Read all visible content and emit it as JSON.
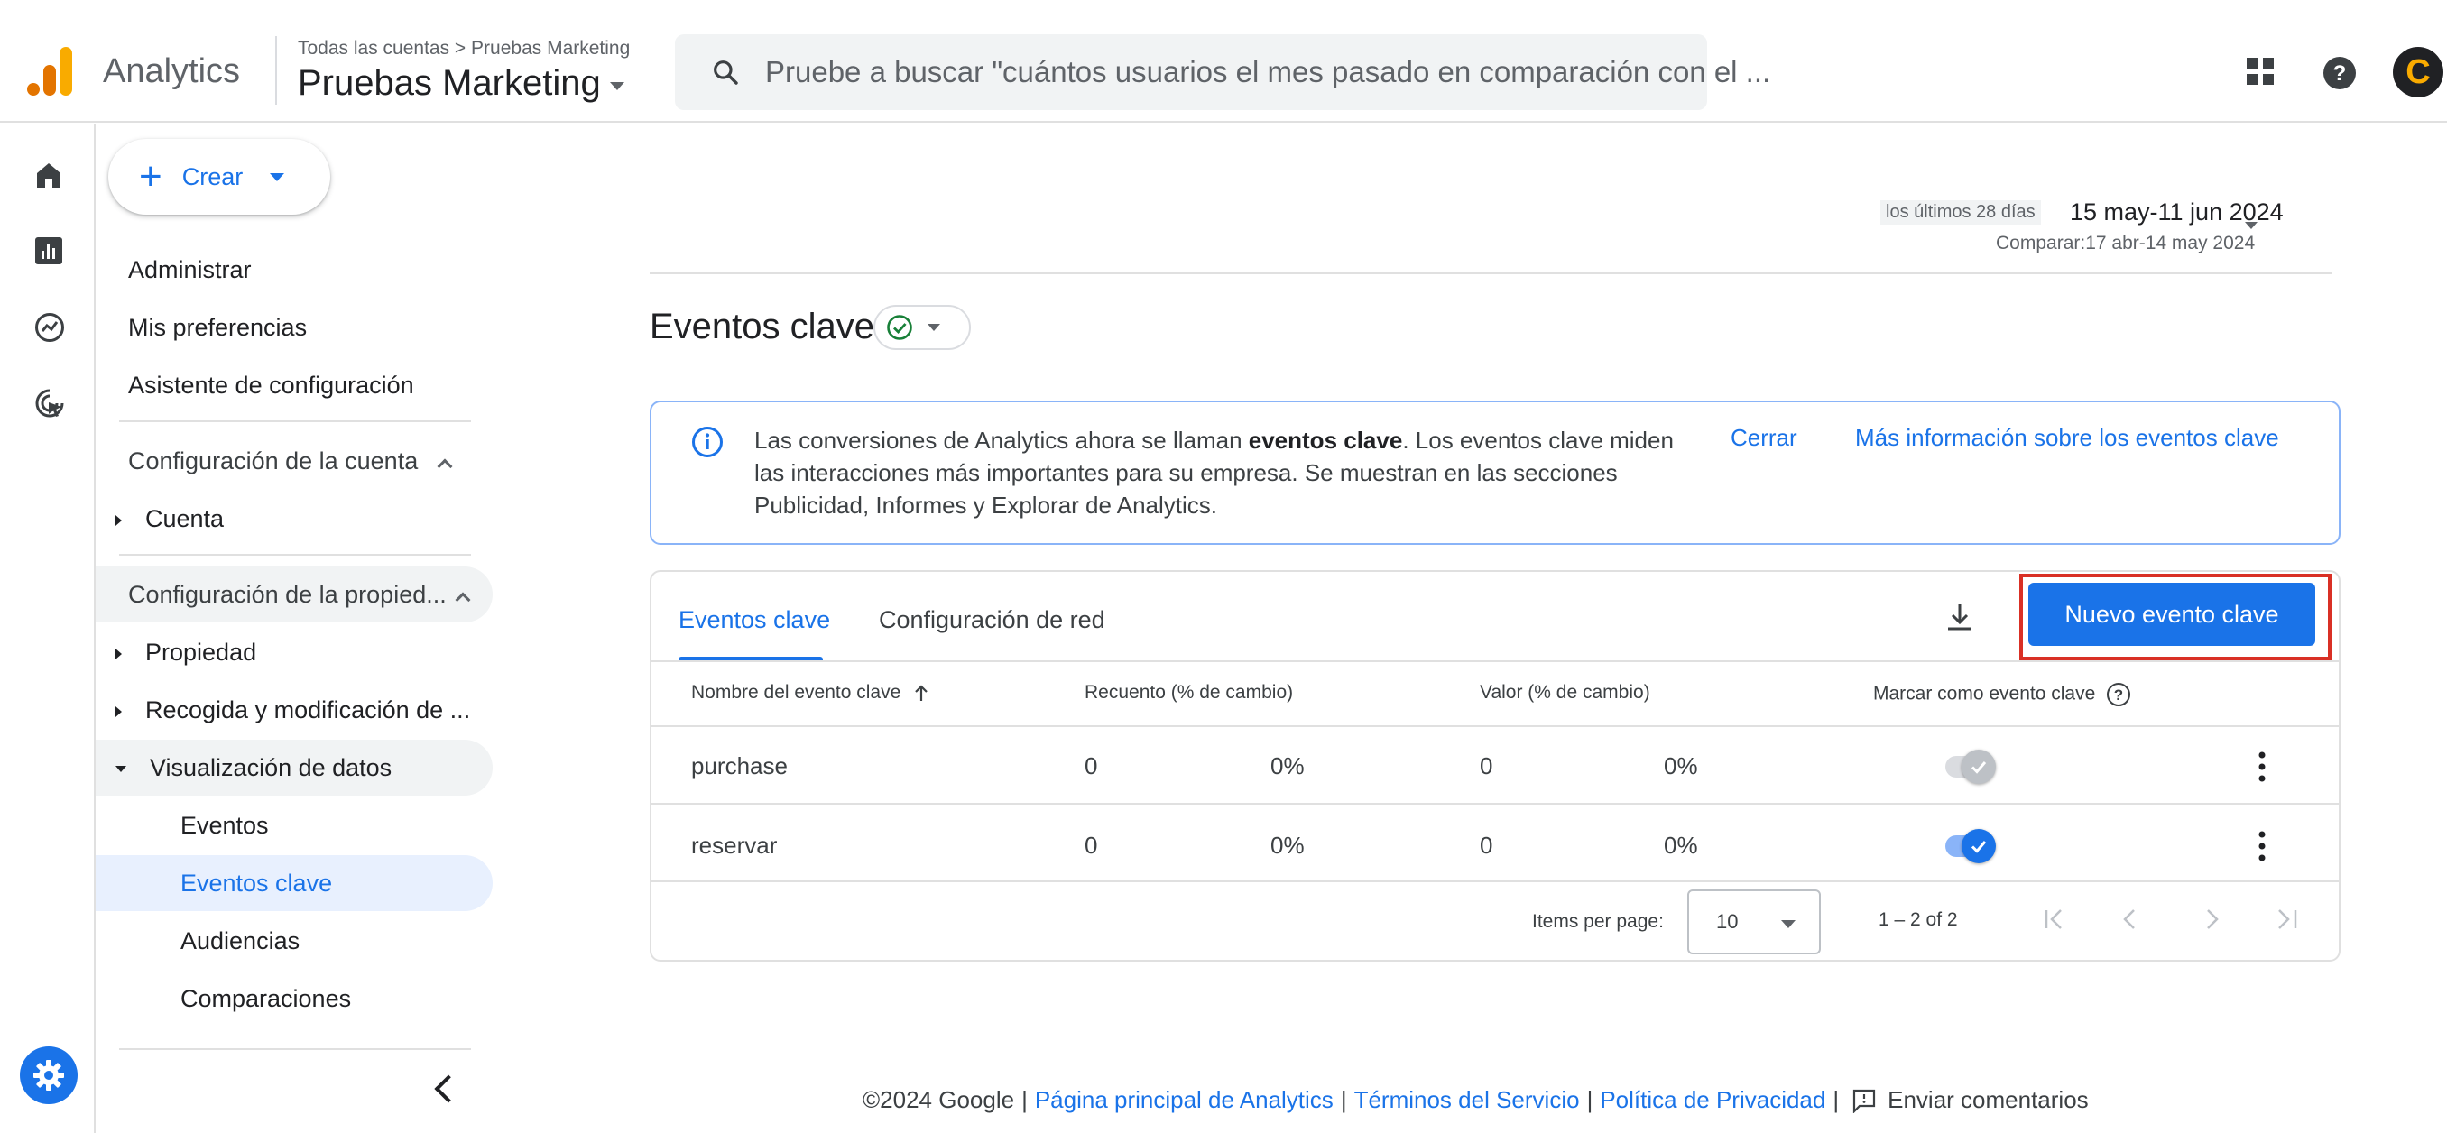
{
  "header": {
    "app_name": "Analytics",
    "breadcrumb": "Todas las cuentas > Pruebas Marketing",
    "property_name": "Pruebas Marketing",
    "search_placeholder": "Pruebe a buscar \"cuántos usuarios el mes pasado en comparación con el ...",
    "avatar_letter": "C"
  },
  "sidebar": {
    "create_label": "Crear",
    "top_items": [
      "Administrar",
      "Mis preferencias",
      "Asistente de configuración"
    ],
    "account_section": "Configuración de la cuenta",
    "account_item": "Cuenta",
    "property_section": "Configuración de la propied...",
    "property_item": "Propiedad",
    "collection_item": "Recogida y modificación de ...",
    "data_display_item": "Visualización de datos",
    "sub_items": [
      "Eventos",
      "Eventos clave",
      "Audiencias",
      "Comparaciones"
    ]
  },
  "date": {
    "label": "los últimos 28 días",
    "range": "15 may-11 jun 2024",
    "compare": "Comparar:17 abr-14 may 2024"
  },
  "page_title": "Eventos clave",
  "banner": {
    "text_before": "Las conversiones de Analytics ahora se llaman ",
    "text_bold": "eventos clave",
    "text_after": ". Los eventos clave miden las interacciones más importantes para su empresa. Se muestran en las secciones Publicidad, Informes y Explorar de Analytics.",
    "close_label": "Cerrar",
    "more_label": "Más información sobre los eventos clave"
  },
  "tabs": [
    "Eventos clave",
    "Configuración de red"
  ],
  "new_button_label": "Nuevo evento clave",
  "table": {
    "columns": [
      "Nombre del evento clave",
      "Recuento (% de cambio)",
      "Valor (% de cambio)",
      "Marcar como evento clave"
    ],
    "rows": [
      {
        "name": "purchase",
        "count": "0",
        "count_change": "0%",
        "value": "0",
        "value_change": "0%",
        "marked": true,
        "disabled": true
      },
      {
        "name": "reservar",
        "count": "0",
        "count_change": "0%",
        "value": "0",
        "value_change": "0%",
        "marked": true,
        "disabled": false
      }
    ]
  },
  "pagination": {
    "items_per_page_label": "Items per page:",
    "items_per_page_value": "10",
    "range_label": "1 – 2 of 2"
  },
  "footer": {
    "copyright": "©2024 Google",
    "links": [
      "Página principal de Analytics",
      "Términos del Servicio",
      "Política de Privacidad"
    ],
    "feedback": "Enviar comentarios"
  },
  "colors": {
    "accent": "#1a73e8",
    "highlight": "#d93025",
    "logo_orange": "#f9ab00",
    "logo_dark_orange": "#e37400"
  }
}
